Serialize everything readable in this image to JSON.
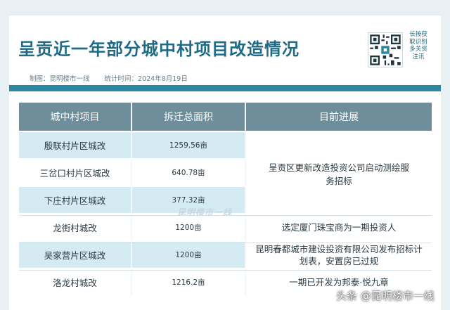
{
  "header": {
    "title": "呈贡近一年部分城中村项目改造情况",
    "author_label": "制图：昆明楼市一线",
    "date_label": "统计时间：2024年8月19日",
    "qr_caption": "长按获取识别多关资注讯"
  },
  "table": {
    "columns": [
      "城中村项目",
      "拆迁总面积",
      "目前进展"
    ],
    "rows": [
      {
        "project": "殷联村片区城改",
        "area": "1259.56亩"
      },
      {
        "project": "三岔口村片区城改",
        "area": "640.78亩"
      },
      {
        "project": "下庄村片区城改",
        "area": "377.32亩"
      },
      {
        "project": "龙街村城改",
        "area": "1200亩",
        "progress": "选定厦门珠宝商为一期投资人"
      },
      {
        "project": "吴家营片区城改",
        "area": "1200亩",
        "progress": "昆明春都城市建设投资有限公司发布招标计划表，安置房已过规"
      },
      {
        "project": "洛龙村城改",
        "area": "1216.2亩",
        "progress": "一期已开发为邦泰·悦九章"
      }
    ],
    "merged_progress": "呈贡区更新改造投资公司启动测绘服务招标"
  },
  "watermark": "昆明楼市一线",
  "footer_watermark": "头条 @昆明楼市一线",
  "colors": {
    "title": "#1f6b86",
    "band": "#2b86a6",
    "header_bg": "#6e8e9b",
    "row_alt": "#d4ebf3"
  }
}
